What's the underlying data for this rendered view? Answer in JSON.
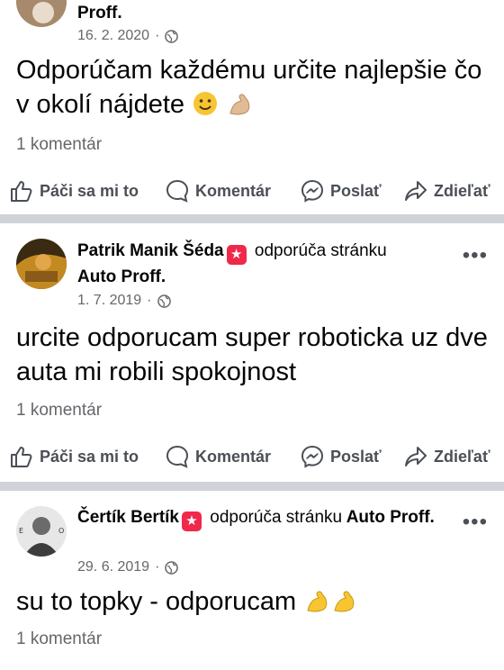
{
  "posts": [
    {
      "author": "",
      "recommends": "",
      "page": "Proff.",
      "date": "16. 2. 2020",
      "text": "Odporúčam každému určite najlepšie čo v okolí nájdete",
      "comments": "1 komentár"
    },
    {
      "author": "Patrik Manik Šéda",
      "recommends": "odporúča stránku",
      "page": "Auto Proff.",
      "date": "1. 7. 2019",
      "text": "urcite odporucam super roboticka uz dve auta mi robili spokojnost",
      "comments": "1 komentár"
    },
    {
      "author": "Čertík Bertík",
      "recommends": "odporúča stránku",
      "page": "Auto Proff.",
      "date": "29. 6. 2019",
      "text": "su to topky - odporucam",
      "comments": "1 komentár"
    }
  ],
  "actions": {
    "like": "Páči sa mi to",
    "comment": "Komentár",
    "send": "Poslať",
    "share": "Zdieľať"
  },
  "more": "•••",
  "colors": {
    "separator": "#cfd2d6",
    "badge": "#f02849",
    "secondary_text": "#65676b"
  }
}
